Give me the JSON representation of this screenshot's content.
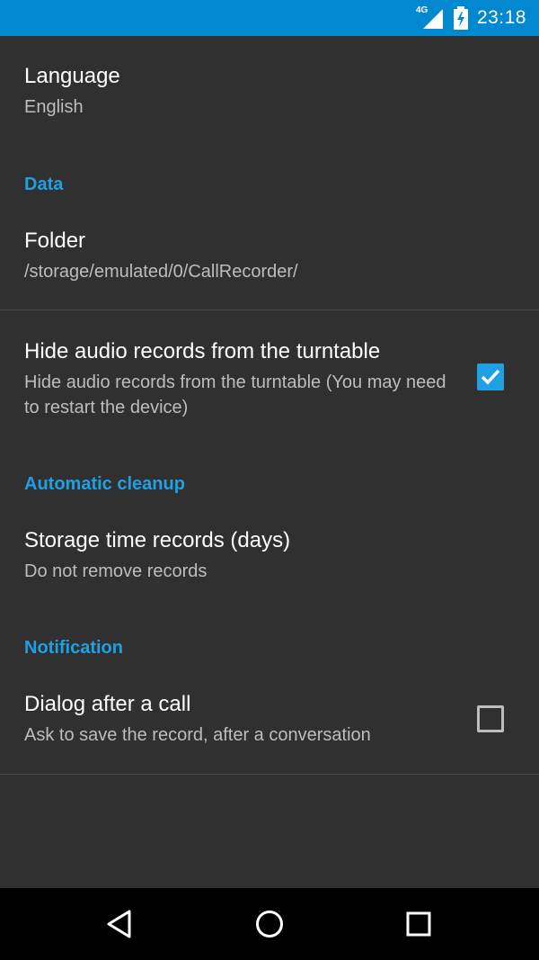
{
  "status_bar": {
    "network": "4G",
    "time": "23:18",
    "icons": [
      "signal-4g-icon",
      "battery-charging-icon"
    ],
    "background": "#0288d1"
  },
  "colors": {
    "background": "#303030",
    "accent": "#1fa0e3",
    "title": "#ffffff",
    "summary": "#bdbdbd"
  },
  "preferences": {
    "language": {
      "title": "Language",
      "summary": "English"
    },
    "data_category": "Data",
    "folder": {
      "title": "Folder",
      "summary": "/storage/emulated/0/CallRecorder/"
    },
    "hide_audio": {
      "title": "Hide audio records from the turntable",
      "summary": "Hide audio records from the turntable (You may need to restart the device)",
      "checked": true
    },
    "cleanup_category": "Automatic cleanup",
    "storage_time": {
      "title": "Storage time records (days)",
      "summary": "Do not remove records"
    },
    "notification_category": "Notification",
    "dialog_after_call": {
      "title": "Dialog after a call",
      "summary": "Ask to save the record, after a conversation",
      "checked": false
    }
  },
  "nav_bar": {
    "icons": [
      "back-icon",
      "home-icon",
      "recents-icon"
    ]
  }
}
